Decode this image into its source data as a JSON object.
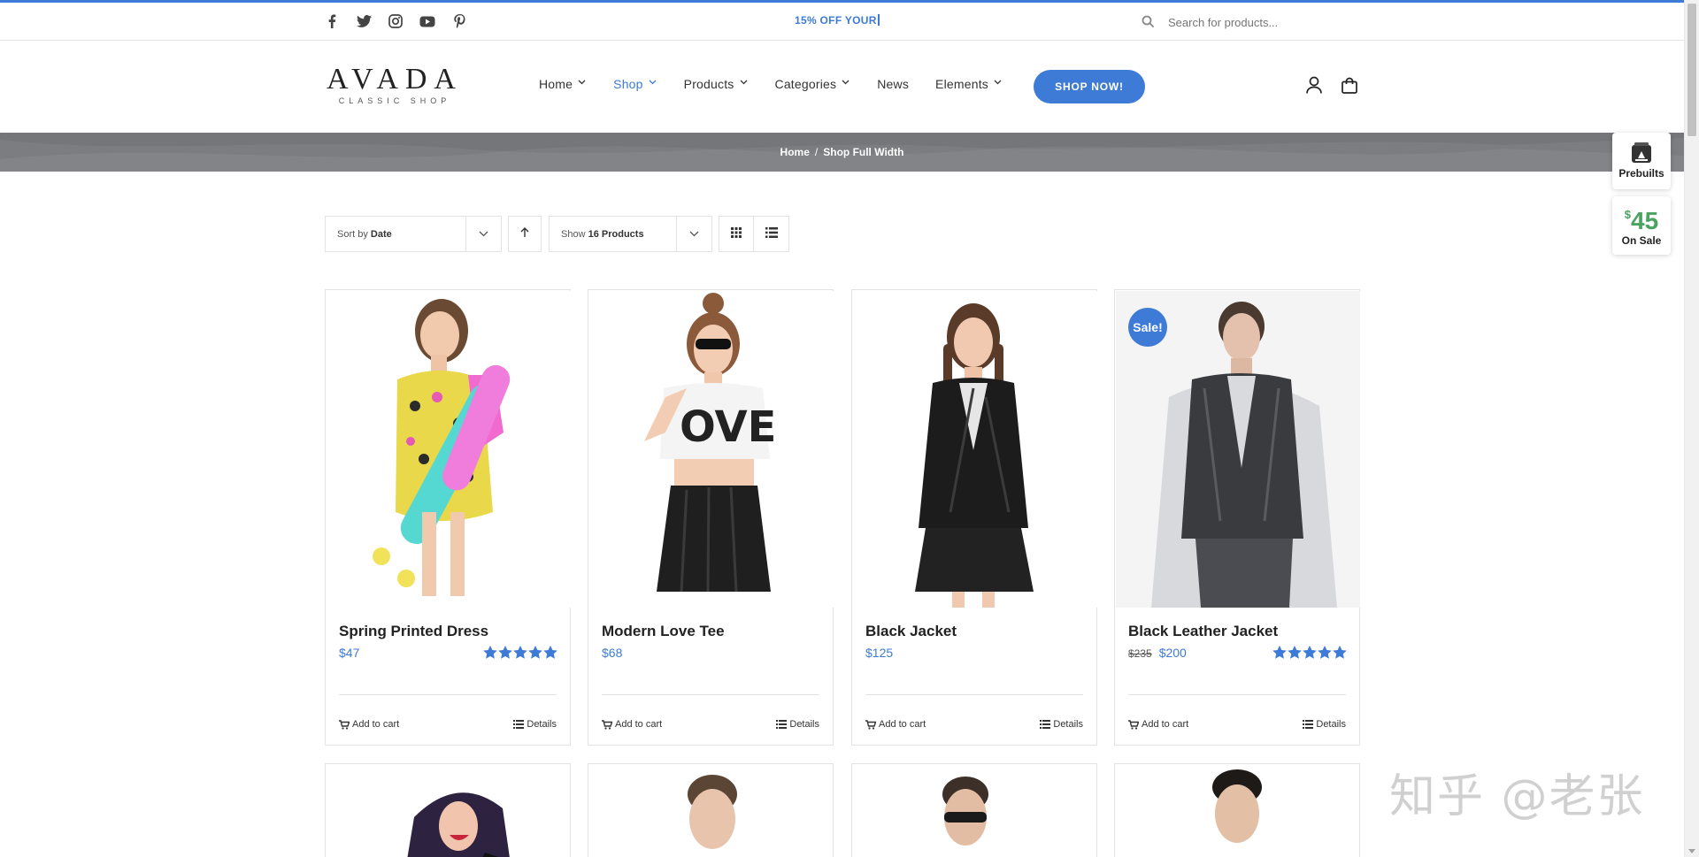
{
  "topbar": {
    "social_icons": [
      "facebook-icon",
      "twitter-icon",
      "instagram-icon",
      "youtube-icon",
      "pinterest-icon"
    ],
    "promo_text": "15% OFF YOUR",
    "search_placeholder": "Search for products..."
  },
  "header": {
    "logo_main": "AVADA",
    "logo_sub": "CLASSIC SHOP",
    "nav": [
      {
        "label": "Home",
        "has_dropdown": true,
        "active": false
      },
      {
        "label": "Shop",
        "has_dropdown": true,
        "active": true
      },
      {
        "label": "Products",
        "has_dropdown": true,
        "active": false
      },
      {
        "label": "Categories",
        "has_dropdown": true,
        "active": false
      },
      {
        "label": "News",
        "has_dropdown": false,
        "active": false
      },
      {
        "label": "Elements",
        "has_dropdown": true,
        "active": false
      }
    ],
    "cta_label": "SHOP NOW!",
    "icons": [
      "user-icon",
      "shopping-bag-icon"
    ]
  },
  "breadcrumb": {
    "home": "Home",
    "separator": "/",
    "current": "Shop Full Width"
  },
  "side_widgets": {
    "prebuilts_label": "Prebuilts",
    "price_currency": "$",
    "price_value": "45",
    "on_sale_label": "On Sale"
  },
  "toolbar": {
    "sort_prefix": "Sort by",
    "sort_value": "Date",
    "show_prefix": "Show",
    "show_value": "16 Products"
  },
  "products": [
    {
      "title": "Spring Printed Dress",
      "price": "$47",
      "old_price": "",
      "rating": 5,
      "sale": false,
      "add_label": "Add to cart",
      "details_label": "Details"
    },
    {
      "title": "Modern Love Tee",
      "price": "$68",
      "old_price": "",
      "rating": 0,
      "sale": false,
      "add_label": "Add to cart",
      "details_label": "Details"
    },
    {
      "title": "Black Jacket",
      "price": "$125",
      "old_price": "",
      "rating": 0,
      "sale": false,
      "add_label": "Add to cart",
      "details_label": "Details"
    },
    {
      "title": "Black Leather Jacket",
      "price": "$200",
      "old_price": "$235",
      "rating": 5,
      "sale": true,
      "sale_label": "Sale!",
      "add_label": "Add to cart",
      "details_label": "Details"
    }
  ],
  "watermark": "知乎 @老张",
  "colors": {
    "accent": "#3d7bd6",
    "banner": "#7b7d80",
    "price_green": "#4aa35f"
  }
}
